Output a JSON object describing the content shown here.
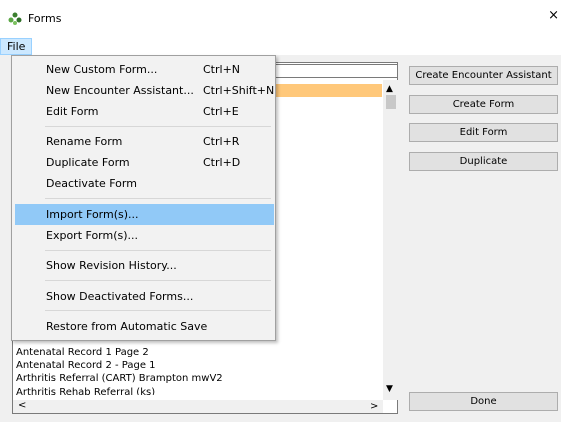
{
  "window": {
    "title": "Forms",
    "close_glyph": "×"
  },
  "menubar": {
    "file_label": "File"
  },
  "file_menu": {
    "items": [
      {
        "label": "New Custom Form...",
        "shortcut": "Ctrl+N"
      },
      {
        "label": "New Encounter Assistant...",
        "shortcut": "Ctrl+Shift+N"
      },
      {
        "label": "Edit Form",
        "shortcut": "Ctrl+E"
      },
      {
        "label": "Rename Form",
        "shortcut": "Ctrl+R"
      },
      {
        "label": "Duplicate Form",
        "shortcut": "Ctrl+D"
      },
      {
        "label": "Deactivate Form",
        "shortcut": ""
      },
      {
        "label": "Import Form(s)...",
        "shortcut": "",
        "highlighted": true
      },
      {
        "label": "Export Form(s)...",
        "shortcut": ""
      },
      {
        "label": "Show Revision History...",
        "shortcut": ""
      },
      {
        "label": "Show Deactivated Forms...",
        "shortcut": ""
      },
      {
        "label": "Restore from Automatic Save",
        "shortcut": ""
      }
    ]
  },
  "forms_list": {
    "rows": [
      "Antenatal Record 1 Page 2",
      "Antenatal Record 2 - Page 1",
      "Arthritis Referral (CART) Brampton mwV2",
      "Arthritis Rehab Referral (ks)"
    ]
  },
  "buttons": {
    "create_encounter_assistant": "Create Encounter Assistant",
    "create_form": "Create Form",
    "edit_form": "Edit Form",
    "duplicate": "Duplicate",
    "done": "Done"
  },
  "colors": {
    "selected_row": "#ffc87a",
    "menu_highlight": "#91c9f7",
    "file_menu_active": "#cce8ff"
  },
  "icons": {
    "app": "forms-app-icon",
    "scroll_up": "▲",
    "scroll_down": "▼",
    "scroll_left": "<",
    "scroll_right": ">"
  }
}
